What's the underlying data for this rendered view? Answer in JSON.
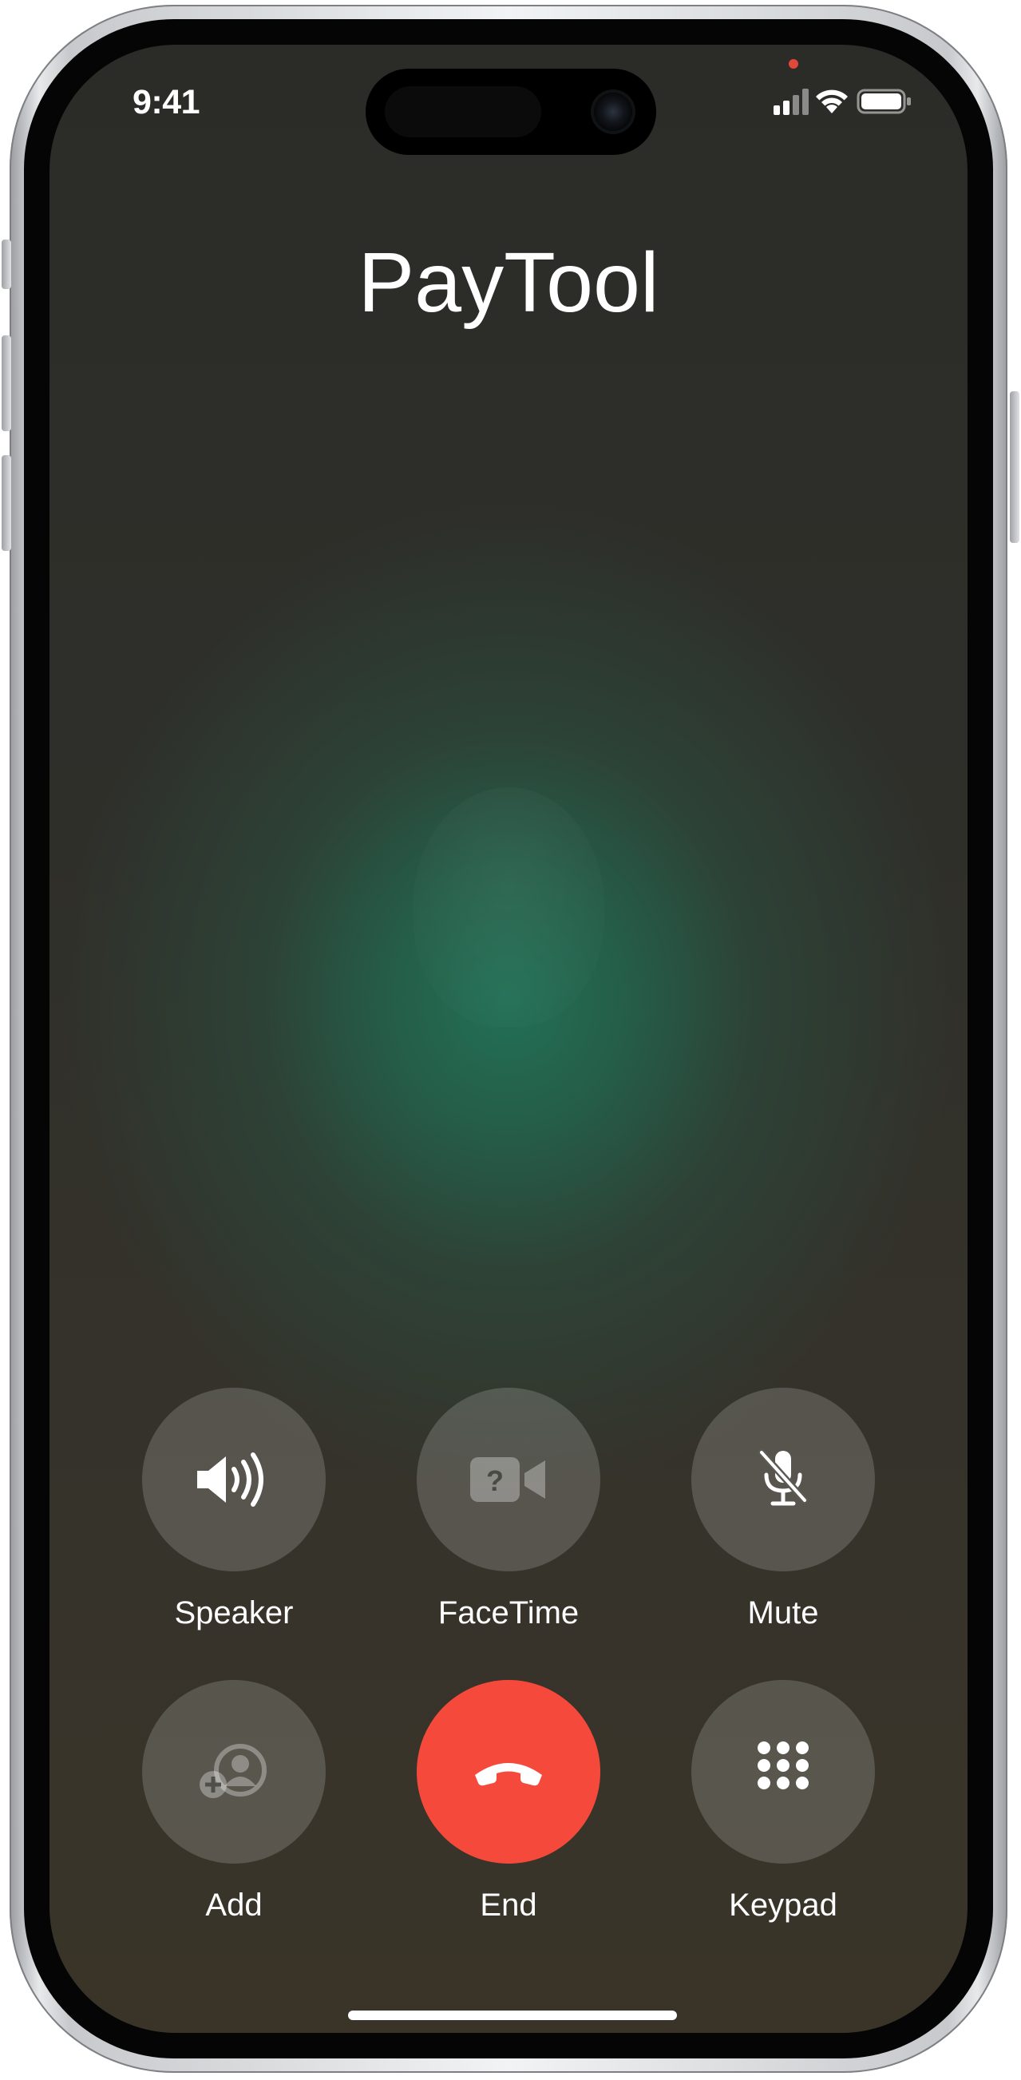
{
  "status_bar": {
    "time": "9:41"
  },
  "call": {
    "caller_name": "PayTool"
  },
  "controls": {
    "row1": [
      {
        "label": "Speaker",
        "icon": "speaker-icon"
      },
      {
        "label": "FaceTime",
        "icon": "facetime-icon"
      },
      {
        "label": "Mute",
        "icon": "mute-icon"
      }
    ],
    "row2": [
      {
        "label": "Add",
        "icon": "add-person-icon"
      },
      {
        "label": "End",
        "icon": "end-call-icon"
      },
      {
        "label": "Keypad",
        "icon": "keypad-icon"
      }
    ]
  },
  "colors": {
    "end_call": "#f54a3b",
    "control_bg": "rgba(255,255,255,0.17)",
    "accent_glow": "#227056"
  }
}
